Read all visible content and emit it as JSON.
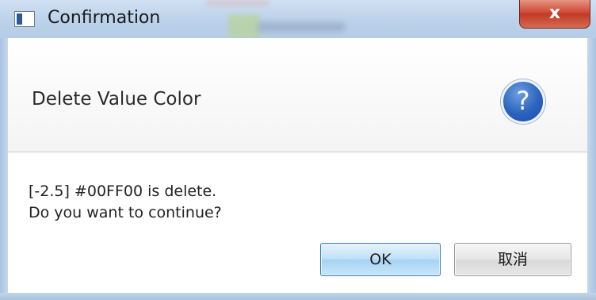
{
  "window": {
    "title": "Confirmation",
    "close_label": "x"
  },
  "dialog": {
    "header_text": "Delete Value Color",
    "icon": "question-icon",
    "icon_glyph": "?",
    "message_line1": "[-2.5] #00FF00 is delete.",
    "message_line2": "Do you want to continue?",
    "ok_label": "OK",
    "cancel_label": "取消"
  },
  "colors": {
    "help_icon": "#2a63be",
    "close_button": "#c13a26",
    "ok_button_border": "#3c7fb1"
  }
}
